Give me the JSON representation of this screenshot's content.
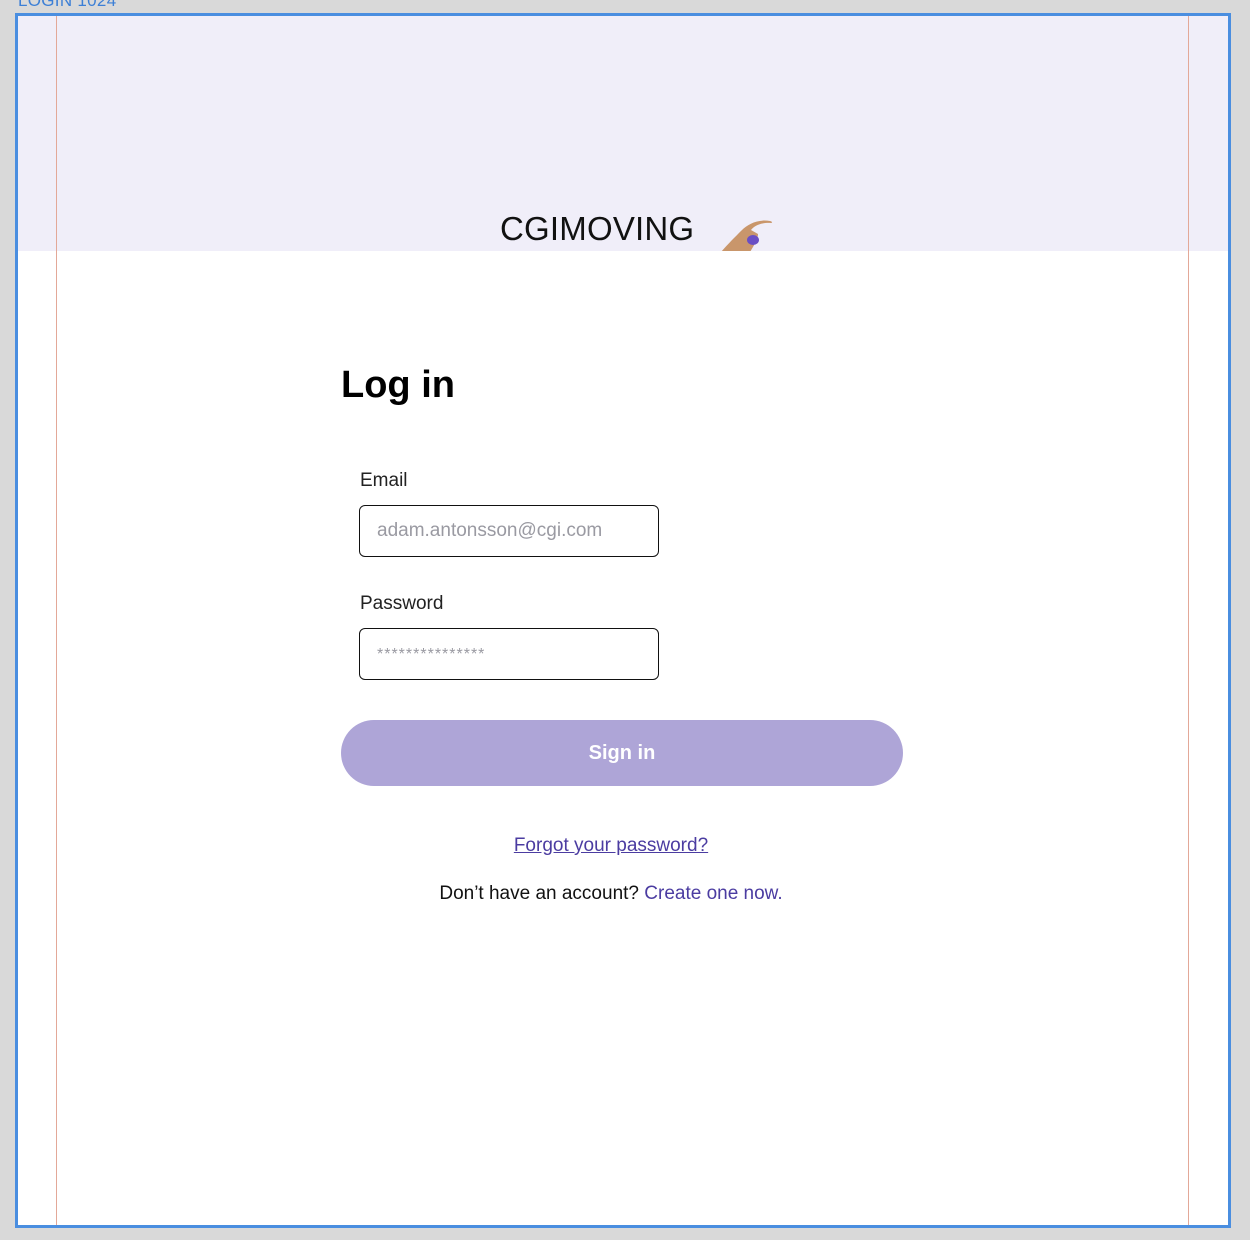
{
  "frame": {
    "label": "LOGIN 1024"
  },
  "header": {
    "brand": "CGIMOVING",
    "logo_icon": "swimmer-icon",
    "band_color": "#f0eef9"
  },
  "form": {
    "title": "Log in",
    "email": {
      "label": "Email",
      "placeholder": "adam.antonsson@cgi.com"
    },
    "password": {
      "label": "Password",
      "placeholder": "***************"
    },
    "submit_label": "Sign in",
    "submit_color": "#aea5d7"
  },
  "links": {
    "forgot_password": "Forgot your password?",
    "no_account_text": "Don’t have an account?",
    "create_account": "Create one now.",
    "link_color": "#4b3ca1"
  }
}
